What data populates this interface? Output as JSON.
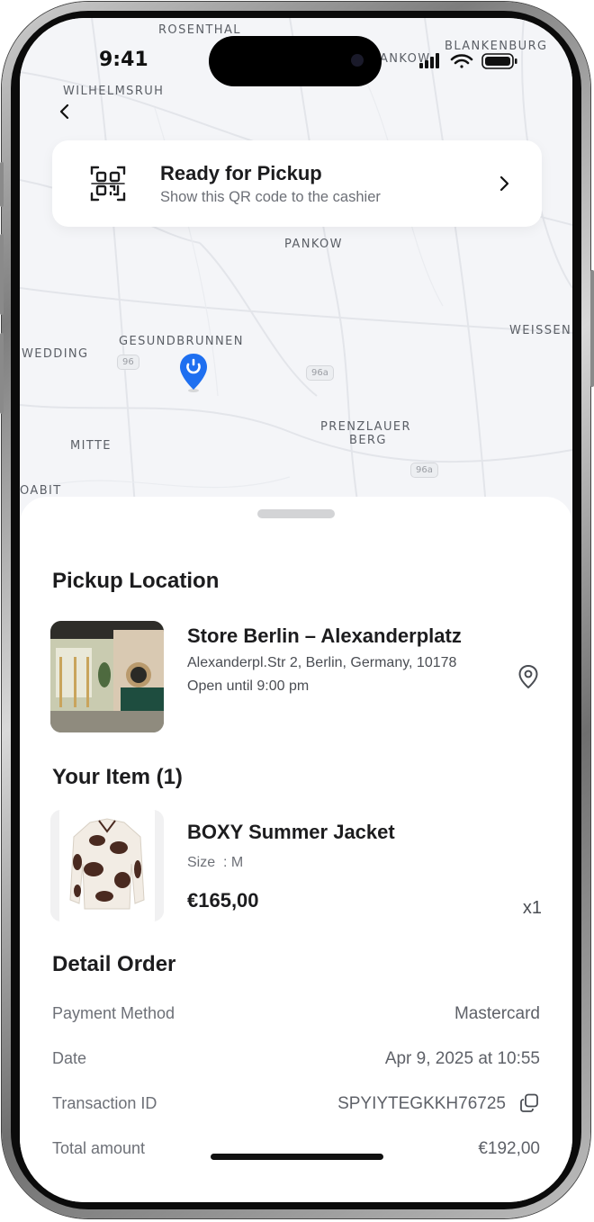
{
  "status_bar": {
    "time": "9:41"
  },
  "map": {
    "labels": {
      "rosenthal": "ROSENTHAL",
      "wilhelmsruh": "WILHELMSRUH",
      "pankow_top": "ANKOW",
      "blankenburg": "BLANKENBURG",
      "pankow": "PANKOW",
      "weissen": "WEISSEN",
      "wedding": "WEDDING",
      "gesundbrunnen": "GESUNDBRUNNEN",
      "mitte": "MITTE",
      "prenzlauer": "PRENZLAUER",
      "berg": "BERG",
      "oabit": "OABIT"
    },
    "route_badges": {
      "r96": "96",
      "r96a_1": "96a",
      "r96a_2": "96a"
    }
  },
  "pickup_card": {
    "title": "Ready for Pickup",
    "subtitle": "Show this QR code to the cashier"
  },
  "pickup_location": {
    "heading": "Pickup Location",
    "store_name": "Store Berlin – Alexanderplatz",
    "address": "Alexanderpl.Str 2, Berlin, Germany, 10178",
    "hours": "Open until 9:00 pm"
  },
  "items": {
    "heading": "Your Item (1)",
    "list": [
      {
        "name": "BOXY Summer Jacket",
        "size": "Size  : M",
        "price": "€165,00",
        "qty": "x1"
      }
    ]
  },
  "detail_order": {
    "heading": "Detail Order",
    "rows": [
      {
        "label": "Payment Method",
        "value": "Mastercard"
      },
      {
        "label": "Date",
        "value": "Apr 9, 2025 at 10:55"
      },
      {
        "label": "Transaction ID",
        "value": "SPYIYTEGKKH76725"
      },
      {
        "label": "Total amount",
        "value": "€192,00"
      }
    ]
  },
  "colors": {
    "accent": "#1e6ff0",
    "text": "#1c1c1e",
    "muted": "#6d7077",
    "map_bg": "#f4f5f8"
  },
  "icons": [
    "back-chevron-icon",
    "qr-code-icon",
    "chevron-right-icon",
    "location-pin-icon",
    "copy-icon",
    "map-pin-icon",
    "signal-icon",
    "wifi-icon",
    "battery-icon"
  ]
}
